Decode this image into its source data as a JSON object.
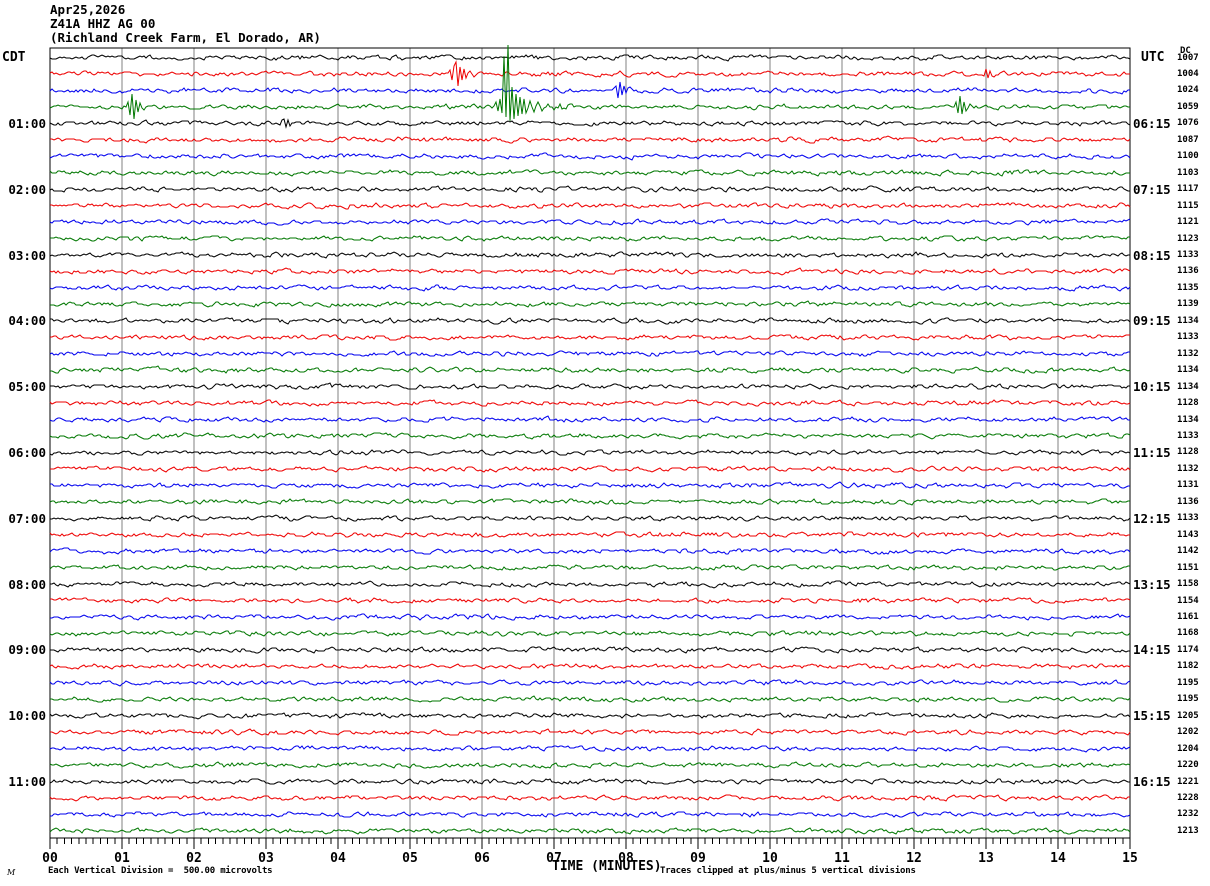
{
  "title": {
    "line1": "Apr25,2026",
    "line2": "Z41A HHZ AG 00",
    "line3": "(Richland Creek Farm, El Dorado, AR)"
  },
  "left_axis": {
    "header": "CDT",
    "labels": [
      {
        "row": 5,
        "text": "01:00"
      },
      {
        "row": 9,
        "text": "02:00"
      },
      {
        "row": 13,
        "text": "03:00"
      },
      {
        "row": 17,
        "text": "04:00"
      },
      {
        "row": 21,
        "text": "05:00"
      },
      {
        "row": 25,
        "text": "06:00"
      },
      {
        "row": 29,
        "text": "07:00"
      },
      {
        "row": 33,
        "text": "08:00"
      },
      {
        "row": 37,
        "text": "09:00"
      },
      {
        "row": 41,
        "text": "10:00"
      },
      {
        "row": 45,
        "text": "11:00"
      }
    ]
  },
  "right_axis": {
    "header": "UTC",
    "labels": [
      {
        "row": 5,
        "text": "06:15"
      },
      {
        "row": 9,
        "text": "07:15"
      },
      {
        "row": 13,
        "text": "08:15"
      },
      {
        "row": 17,
        "text": "09:15"
      },
      {
        "row": 21,
        "text": "10:15"
      },
      {
        "row": 25,
        "text": "11:15"
      },
      {
        "row": 29,
        "text": "12:15"
      },
      {
        "row": 33,
        "text": "13:15"
      },
      {
        "row": 37,
        "text": "14:15"
      },
      {
        "row": 41,
        "text": "15:15"
      },
      {
        "row": 45,
        "text": "16:15"
      }
    ]
  },
  "dc_column": {
    "header": "DC"
  },
  "x_axis": {
    "title": "TIME (MINUTES)",
    "tick_labels": [
      "00",
      "01",
      "02",
      "03",
      "04",
      "05",
      "06",
      "07",
      "08",
      "09",
      "10",
      "11",
      "12",
      "13",
      "14",
      "15"
    ]
  },
  "footer": {
    "watermark": "M",
    "scale_note": "Each Vertical Division =  500.00 microvolts",
    "clip_note": "Traces clipped at plus/minus 5 vertical divisions"
  },
  "colors": {
    "trace_cycle": [
      "#000000",
      "#ee0000",
      "#0000ee",
      "#007700"
    ],
    "grid": "#808080",
    "border": "#000000",
    "background": "#ffffff"
  },
  "chart_data": {
    "type": "line",
    "description": "Helicorder (webicorder) seismogram: 48 consecutive 15-minute traces (4 per hour), colors cycling black/red/blue/green, showing ambient seismic noise with a few transient events; largest event is a clipped spike on the 00:45 CDT (green) trace near minute 6.3.",
    "station": "Z41A HHZ AG 00",
    "site": "Richland Creek Farm, El Dorado, AR",
    "date": "Apr25,2026",
    "minutes_per_line": 15,
    "traces": 48,
    "traces_per_hour": 4,
    "first_trace_start_cdt": "00:00",
    "last_trace_start_cdt": "11:45",
    "utc_offset_rule": "UTC = CDT + 5h; right labels give UTC end-time of each hour's first trace",
    "vertical_division_microvolts": 500.0,
    "clip_divisions": 5,
    "x_range_minutes": [
      0,
      15
    ],
    "grid": "vertical line each minute",
    "dc_offsets": [
      1007,
      1004,
      1024,
      1059,
      1076,
      1087,
      1100,
      1103,
      1117,
      1115,
      1121,
      1123,
      1133,
      1136,
      1135,
      1139,
      1134,
      1133,
      1132,
      1134,
      1134,
      1128,
      1134,
      1133,
      1128,
      1132,
      1131,
      1136,
      1133,
      1143,
      1142,
      1151,
      1158,
      1154,
      1161,
      1168,
      1174,
      1182,
      1195,
      1195,
      1205,
      1202,
      1204,
      1220,
      1221,
      1228,
      1232,
      1213
    ],
    "events": [
      {
        "row": 4,
        "trace_start_cdt": "00:45",
        "approx_minute": 6.31,
        "clipped": true,
        "spikes": [
          [
            -8,
            5
          ],
          [
            -6,
            -4
          ],
          [
            -4,
            8
          ],
          [
            -2,
            -6
          ],
          [
            0,
            51
          ],
          [
            2,
            -10
          ],
          [
            4,
            62
          ],
          [
            6,
            -14
          ],
          [
            8,
            20
          ],
          [
            10,
            -12
          ],
          [
            12,
            13
          ],
          [
            14,
            -9
          ],
          [
            16,
            10
          ],
          [
            18,
            -7
          ],
          [
            20,
            8
          ],
          [
            22,
            -6
          ],
          [
            26,
            6
          ],
          [
            30,
            -5
          ],
          [
            34,
            5
          ],
          [
            38,
            -4
          ],
          [
            44,
            3
          ],
          [
            50,
            -3
          ],
          [
            56,
            3
          ],
          [
            62,
            -2
          ]
        ]
      },
      {
        "row": 2,
        "trace_start_cdt": "00:15",
        "approx_minute": 5.65,
        "clipped": false,
        "spikes": [
          [
            -6,
            4
          ],
          [
            -4,
            -6
          ],
          [
            -2,
            8
          ],
          [
            0,
            12
          ],
          [
            2,
            -12
          ],
          [
            4,
            7
          ],
          [
            6,
            -6
          ],
          [
            8,
            5
          ],
          [
            10,
            -4
          ],
          [
            14,
            3
          ],
          [
            18,
            -3
          ]
        ]
      },
      {
        "row": 3,
        "trace_start_cdt": "00:30",
        "approx_minute": 7.89,
        "clipped": false,
        "spikes": [
          [
            -2,
            4
          ],
          [
            0,
            -8
          ],
          [
            2,
            8
          ],
          [
            4,
            -5
          ],
          [
            6,
            4
          ],
          [
            8,
            -3
          ],
          [
            12,
            3
          ]
        ]
      },
      {
        "row": 4,
        "trace_start_cdt": "00:45",
        "approx_minute": 1.14,
        "clipped": false,
        "spikes": [
          [
            -4,
            5
          ],
          [
            -2,
            -8
          ],
          [
            0,
            13
          ],
          [
            2,
            -12
          ],
          [
            4,
            7
          ],
          [
            6,
            -5
          ],
          [
            8,
            4
          ],
          [
            12,
            -3
          ]
        ]
      },
      {
        "row": 4,
        "trace_start_cdt": "00:45",
        "approx_minute": 12.61,
        "clipped": false,
        "spikes": [
          [
            -2,
            5
          ],
          [
            0,
            -6
          ],
          [
            2,
            11
          ],
          [
            4,
            -7
          ],
          [
            6,
            5
          ],
          [
            8,
            -4
          ],
          [
            12,
            3
          ]
        ]
      },
      {
        "row": 2,
        "trace_start_cdt": "00:15",
        "approx_minute": 13.01,
        "clipped": false,
        "spikes": [
          [
            0,
            5
          ],
          [
            2,
            -4
          ],
          [
            4,
            3
          ]
        ]
      },
      {
        "row": 5,
        "trace_start_cdt": "01:00",
        "approx_minute": 3.26,
        "clipped": false,
        "spikes": [
          [
            -2,
            3
          ],
          [
            0,
            4
          ],
          [
            2,
            -4
          ],
          [
            4,
            3
          ],
          [
            6,
            -3
          ]
        ]
      }
    ]
  }
}
